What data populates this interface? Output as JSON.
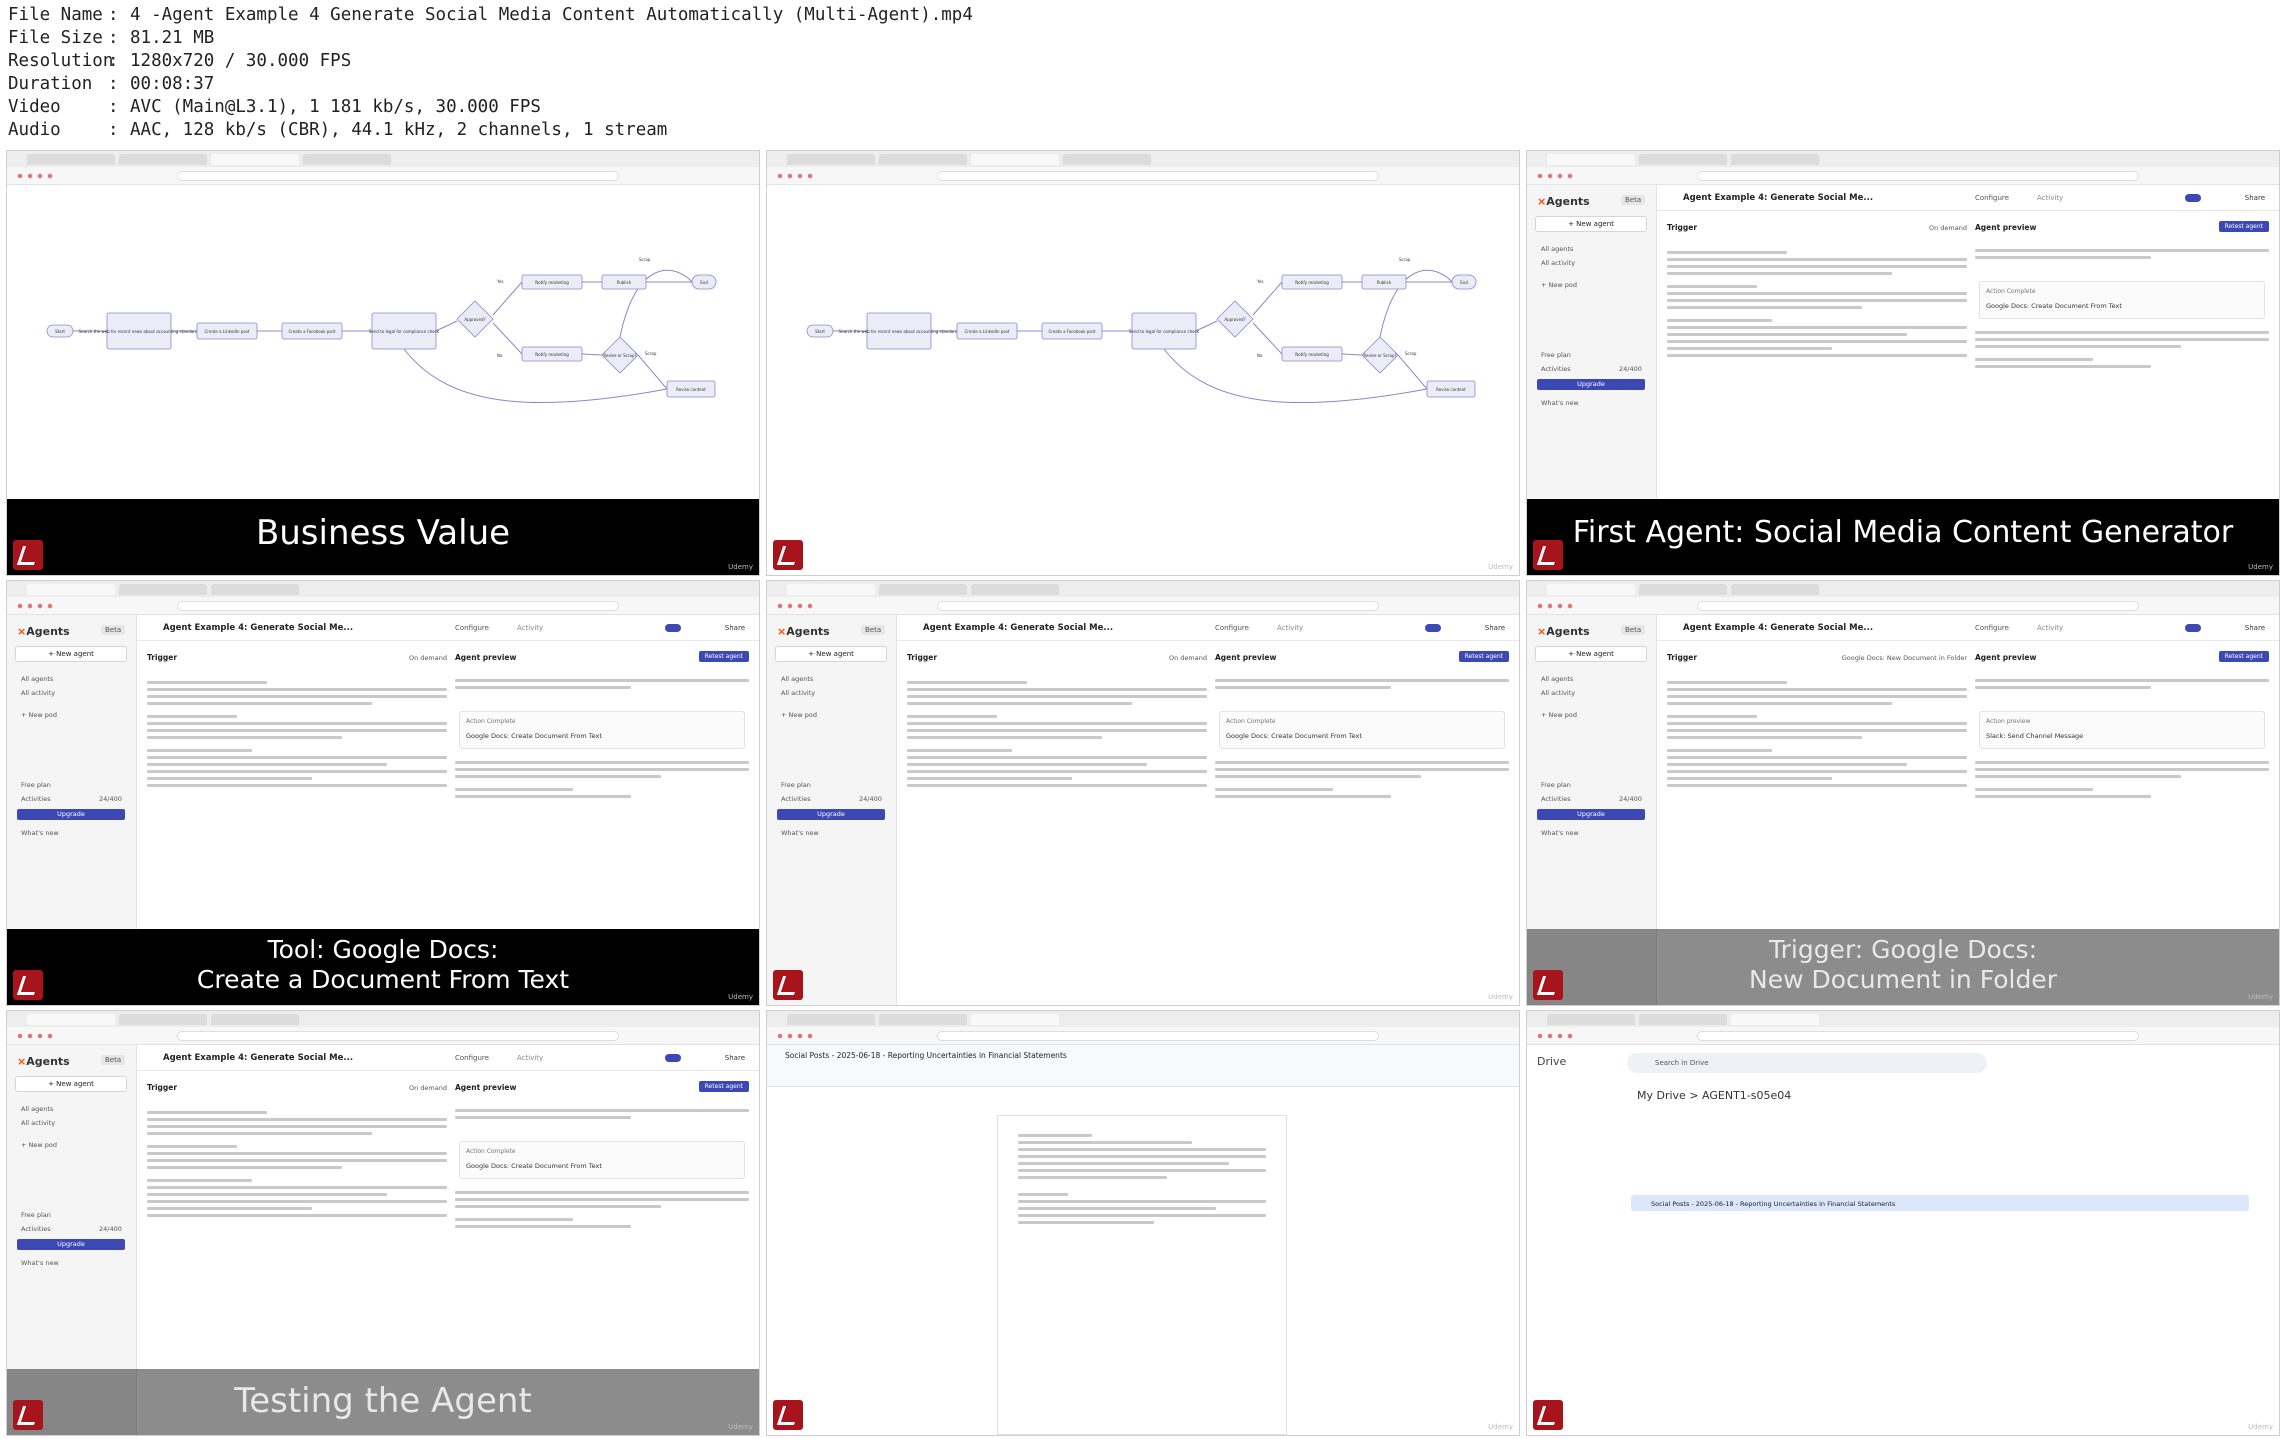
{
  "file_info": [
    {
      "key": "File Name",
      "value": "4 -Agent Example 4 Generate Social Media Content Automatically (Multi-Agent).mp4"
    },
    {
      "key": "File Size",
      "value": "81.21 MB"
    },
    {
      "key": "Resolution",
      "value": "1280x720 / 30.000 FPS"
    },
    {
      "key": "Duration",
      "value": "00:08:37"
    },
    {
      "key": "Video",
      "value": "AVC (Main@L3.1), 1 181 kb/s, 30.000 FPS"
    },
    {
      "key": "Audio",
      "value": "AAC, 128 kb/s (CBR), 44.1 kHz, 2 channels, 1 stream"
    }
  ],
  "watermark": "Udemy",
  "flow": {
    "start": "Start",
    "search": "Search the web for recent news about accounting standards",
    "linkedin": "Create a LinkedIn post",
    "facebook": "Create a Facebook post",
    "legal": "Send to legal for compliance check",
    "approved": "Approved?",
    "yes": "Yes",
    "no": "No",
    "notify_top": "Notify marketing",
    "notify_bottom": "Notify marketing",
    "publish": "Publish",
    "revise": "Revise or Scrap?",
    "revise_content": "Revise content",
    "scrap": "Scrap",
    "end": "End"
  },
  "zapier": {
    "brand": "Agents",
    "beta": "Beta",
    "new_agent": "+ New agent",
    "all_agents": "All agents",
    "all_activity": "All activity",
    "new_pod": "+ New pod",
    "free_plan": "Free plan",
    "activities": "Activities",
    "activities_count": "24/400",
    "upgrade": "Upgrade",
    "whats_new": "What's new",
    "title": "Agent Example 4: Generate Social Me...",
    "configure": "Configure",
    "activity": "Activity",
    "share": "Share",
    "trigger": "Trigger",
    "on_demand": "On demand",
    "trigger_folder": "Google Docs: New Document in Folder",
    "agent_preview": "Agent preview",
    "retest": "Retest agent",
    "action_complete": "Action Complete",
    "action_name": "Google Docs: Create Document From Text",
    "action_slack": "Slack: Send Channel Message",
    "action_preview": "Action preview"
  },
  "docs": {
    "title": "Social Posts - 2025-06-18 - Reporting Uncertainties in Financial Statements"
  },
  "drive": {
    "brand": "Drive",
    "search": "Search in Drive",
    "crumb": "My Drive  >  AGENT1-s05e04",
    "file": "Social Posts - 2025-06-18 - Reporting Uncertainties in Financial Statements"
  },
  "banners": {
    "t1": "Business Value",
    "t3": "First Agent: Social Media Content Generator",
    "t4_line1": "Tool: Google Docs:",
    "t4_line2": "Create a Document From Text",
    "t6_line1": "Trigger: Google Docs:",
    "t6_line2": "New Document in Folder",
    "t7": "Testing the Agent"
  }
}
